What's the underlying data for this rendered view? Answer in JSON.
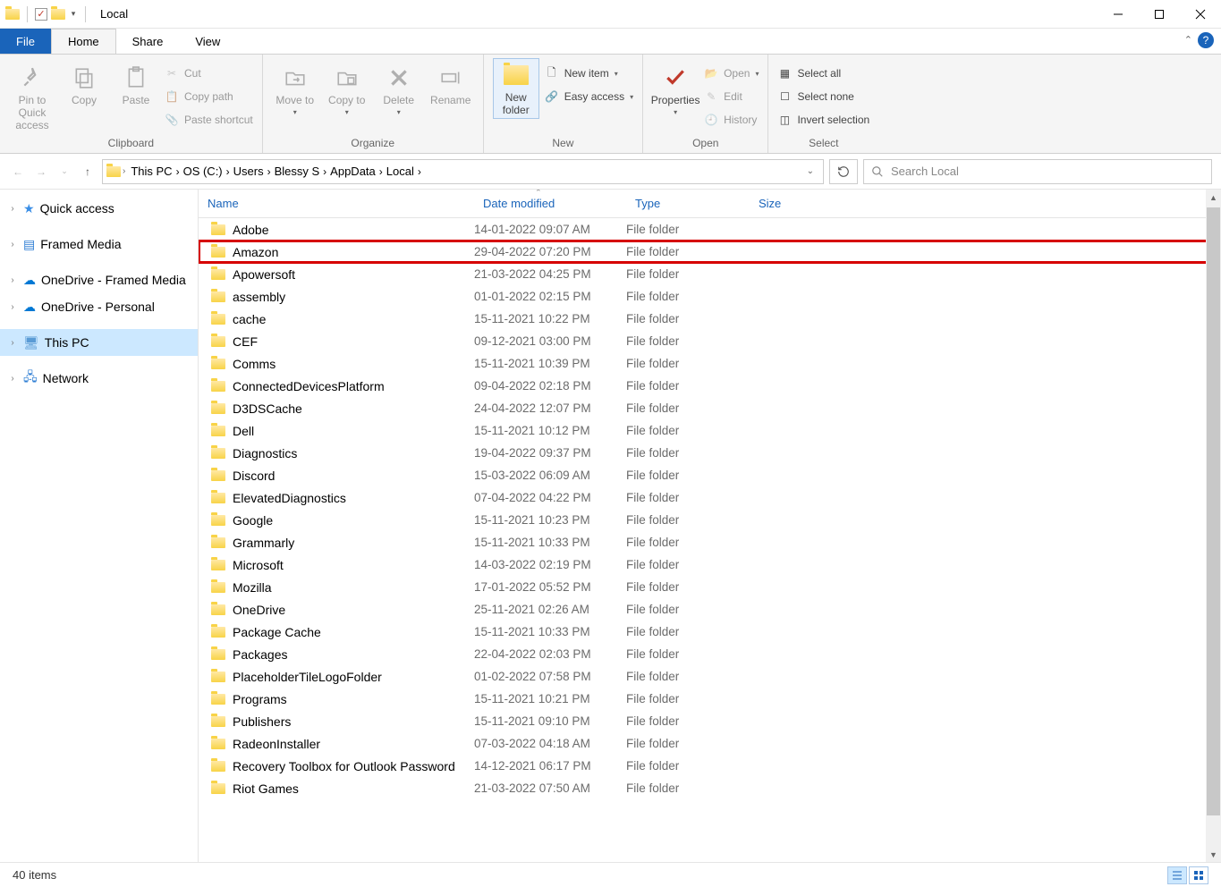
{
  "window": {
    "title": "Local"
  },
  "tabs": {
    "file": "File",
    "home": "Home",
    "share": "Share",
    "view": "View"
  },
  "ribbon": {
    "clipboard": {
      "label": "Clipboard",
      "pin": "Pin to Quick access",
      "copy": "Copy",
      "paste": "Paste",
      "cut": "Cut",
      "copy_path": "Copy path",
      "paste_shortcut": "Paste shortcut"
    },
    "organize": {
      "label": "Organize",
      "move_to": "Move to",
      "copy_to": "Copy to",
      "delete": "Delete",
      "rename": "Rename"
    },
    "new": {
      "label": "New",
      "new_folder": "New folder",
      "new_item": "New item",
      "easy_access": "Easy access"
    },
    "open": {
      "label": "Open",
      "properties": "Properties",
      "open": "Open",
      "edit": "Edit",
      "history": "History"
    },
    "select": {
      "label": "Select",
      "select_all": "Select all",
      "select_none": "Select none",
      "invert": "Invert selection"
    }
  },
  "breadcrumbs": [
    "This PC",
    "OS (C:)",
    "Users",
    "Blessy S",
    "AppData",
    "Local"
  ],
  "search_placeholder": "Search Local",
  "sidebar": {
    "items": [
      {
        "label": "Quick access",
        "kind": "qa"
      },
      {
        "label": "Framed Media",
        "kind": "fm"
      },
      {
        "label": "OneDrive - Framed Media",
        "kind": "od"
      },
      {
        "label": "OneDrive - Personal",
        "kind": "od"
      },
      {
        "label": "This PC",
        "kind": "pc",
        "selected": true
      },
      {
        "label": "Network",
        "kind": "net"
      }
    ]
  },
  "columns": {
    "name": "Name",
    "date": "Date modified",
    "type": "Type",
    "size": "Size"
  },
  "files": [
    {
      "name": "Adobe",
      "date": "14-01-2022 09:07 AM",
      "type": "File folder"
    },
    {
      "name": "Amazon",
      "date": "29-04-2022 07:20 PM",
      "type": "File folder",
      "highlight": true
    },
    {
      "name": "Apowersoft",
      "date": "21-03-2022 04:25 PM",
      "type": "File folder"
    },
    {
      "name": "assembly",
      "date": "01-01-2022 02:15 PM",
      "type": "File folder"
    },
    {
      "name": "cache",
      "date": "15-11-2021 10:22 PM",
      "type": "File folder"
    },
    {
      "name": "CEF",
      "date": "09-12-2021 03:00 PM",
      "type": "File folder"
    },
    {
      "name": "Comms",
      "date": "15-11-2021 10:39 PM",
      "type": "File folder"
    },
    {
      "name": "ConnectedDevicesPlatform",
      "date": "09-04-2022 02:18 PM",
      "type": "File folder"
    },
    {
      "name": "D3DSCache",
      "date": "24-04-2022 12:07 PM",
      "type": "File folder"
    },
    {
      "name": "Dell",
      "date": "15-11-2021 10:12 PM",
      "type": "File folder"
    },
    {
      "name": "Diagnostics",
      "date": "19-04-2022 09:37 PM",
      "type": "File folder"
    },
    {
      "name": "Discord",
      "date": "15-03-2022 06:09 AM",
      "type": "File folder"
    },
    {
      "name": "ElevatedDiagnostics",
      "date": "07-04-2022 04:22 PM",
      "type": "File folder"
    },
    {
      "name": "Google",
      "date": "15-11-2021 10:23 PM",
      "type": "File folder"
    },
    {
      "name": "Grammarly",
      "date": "15-11-2021 10:33 PM",
      "type": "File folder"
    },
    {
      "name": "Microsoft",
      "date": "14-03-2022 02:19 PM",
      "type": "File folder"
    },
    {
      "name": "Mozilla",
      "date": "17-01-2022 05:52 PM",
      "type": "File folder"
    },
    {
      "name": "OneDrive",
      "date": "25-11-2021 02:26 AM",
      "type": "File folder"
    },
    {
      "name": "Package Cache",
      "date": "15-11-2021 10:33 PM",
      "type": "File folder"
    },
    {
      "name": "Packages",
      "date": "22-04-2022 02:03 PM",
      "type": "File folder"
    },
    {
      "name": "PlaceholderTileLogoFolder",
      "date": "01-02-2022 07:58 PM",
      "type": "File folder"
    },
    {
      "name": "Programs",
      "date": "15-11-2021 10:21 PM",
      "type": "File folder"
    },
    {
      "name": "Publishers",
      "date": "15-11-2021 09:10 PM",
      "type": "File folder"
    },
    {
      "name": "RadeonInstaller",
      "date": "07-03-2022 04:18 AM",
      "type": "File folder"
    },
    {
      "name": "Recovery Toolbox for Outlook Password",
      "date": "14-12-2021 06:17 PM",
      "type": "File folder"
    },
    {
      "name": "Riot Games",
      "date": "21-03-2022 07:50 AM",
      "type": "File folder"
    }
  ],
  "status": {
    "count": "40 items"
  }
}
